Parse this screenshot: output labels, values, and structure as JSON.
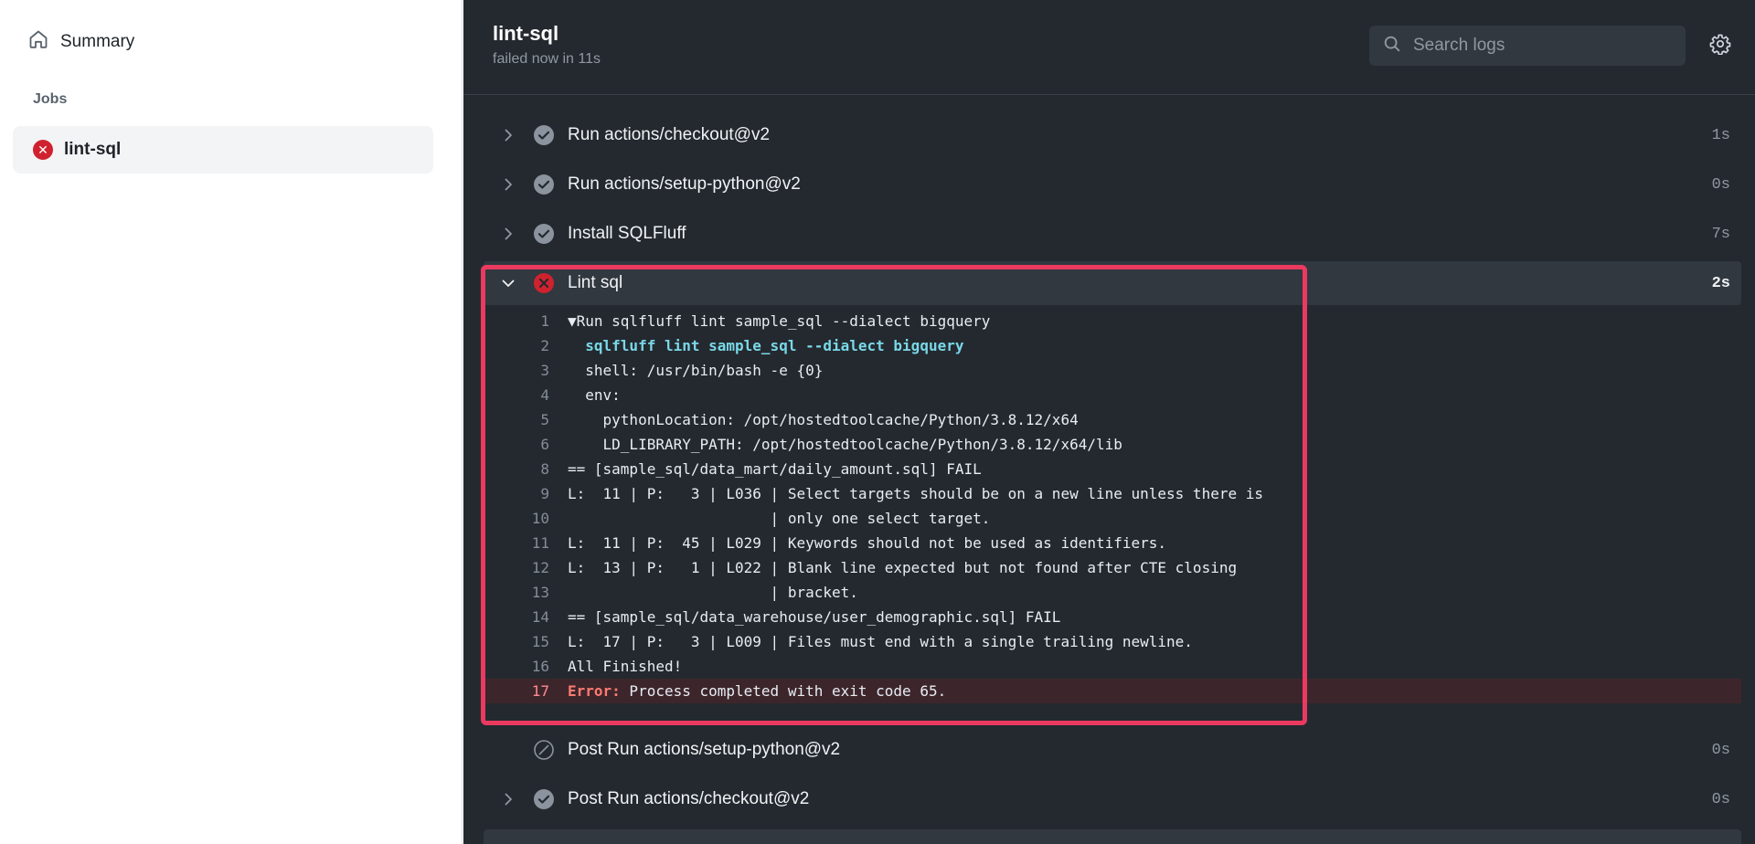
{
  "sidebar": {
    "summary_label": "Summary",
    "jobs_heading": "Jobs",
    "job_label": "lint-sql"
  },
  "header": {
    "title": "lint-sql",
    "status": "failed now in 11s",
    "search_placeholder": "Search logs"
  },
  "steps": [
    {
      "label": "Run actions/checkout@v2",
      "duration": "1s",
      "status": "success"
    },
    {
      "label": "Run actions/setup-python@v2",
      "duration": "0s",
      "status": "success"
    },
    {
      "label": "Install SQLFluff",
      "duration": "7s",
      "status": "success"
    },
    {
      "label": "Lint sql",
      "duration": "2s",
      "status": "failure"
    },
    {
      "label": "Post Run actions/setup-python@v2",
      "duration": "0s",
      "status": "skipped"
    },
    {
      "label": "Post Run actions/checkout@v2",
      "duration": "0s",
      "status": "success"
    }
  ],
  "log_lines": [
    {
      "n": "1",
      "text": "▼Run sqlfluff lint sample_sql --dialect bigquery"
    },
    {
      "n": "2",
      "text": "  sqlfluff lint sample_sql --dialect bigquery"
    },
    {
      "n": "3",
      "text": "  shell: /usr/bin/bash -e {0}"
    },
    {
      "n": "4",
      "text": "  env:"
    },
    {
      "n": "5",
      "text": "    pythonLocation: /opt/hostedtoolcache/Python/3.8.12/x64"
    },
    {
      "n": "6",
      "text": "    LD_LIBRARY_PATH: /opt/hostedtoolcache/Python/3.8.12/x64/lib"
    },
    {
      "n": "8",
      "text": "== [sample_sql/data_mart/daily_amount.sql] FAIL"
    },
    {
      "n": "9",
      "text": "L:  11 | P:   3 | L036 | Select targets should be on a new line unless there is"
    },
    {
      "n": "10",
      "text": "                       | only one select target."
    },
    {
      "n": "11",
      "text": "L:  11 | P:  45 | L029 | Keywords should not be used as identifiers."
    },
    {
      "n": "12",
      "text": "L:  13 | P:   1 | L022 | Blank line expected but not found after CTE closing"
    },
    {
      "n": "13",
      "text": "                       | bracket."
    },
    {
      "n": "14",
      "text": "== [sample_sql/data_warehouse/user_demographic.sql] FAIL"
    },
    {
      "n": "15",
      "text": "L:  17 | P:   3 | L009 | Files must end with a single trailing newline."
    },
    {
      "n": "16",
      "text": "All Finished!"
    },
    {
      "n": "17",
      "prefix": "Error:",
      "text": " Process completed with exit code 65."
    }
  ],
  "colors": {
    "accent_highlight": "#ea3a5f",
    "success": "#8b949e",
    "failure": "#cf222e",
    "command": "#79d8e8"
  }
}
